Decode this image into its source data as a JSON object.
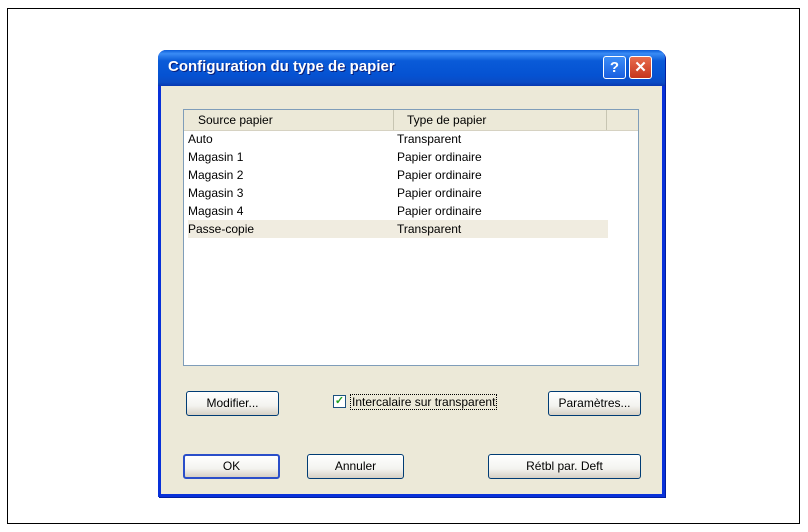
{
  "dialog": {
    "title": "Configuration du type de papier",
    "help_label": "?",
    "close_label": "✕"
  },
  "list": {
    "columns": [
      "Source papier",
      "Type de papier"
    ],
    "rows": [
      {
        "source": "Auto",
        "type": "Transparent"
      },
      {
        "source": "Magasin 1",
        "type": "Papier ordinaire"
      },
      {
        "source": "Magasin 2",
        "type": "Papier ordinaire"
      },
      {
        "source": "Magasin 3",
        "type": "Papier ordinaire"
      },
      {
        "source": "Magasin 4",
        "type": "Papier ordinaire"
      },
      {
        "source": "Passe-copie",
        "type": "Transparent"
      }
    ],
    "selected_index": 5
  },
  "buttons": {
    "modify": "Modifier...",
    "parameters": "Paramètres...",
    "ok": "OK",
    "cancel": "Annuler",
    "reset": "Rétbl par. Deft"
  },
  "checkbox": {
    "label": "Intercalaire sur transparent",
    "checked": true,
    "mark": "✓"
  }
}
